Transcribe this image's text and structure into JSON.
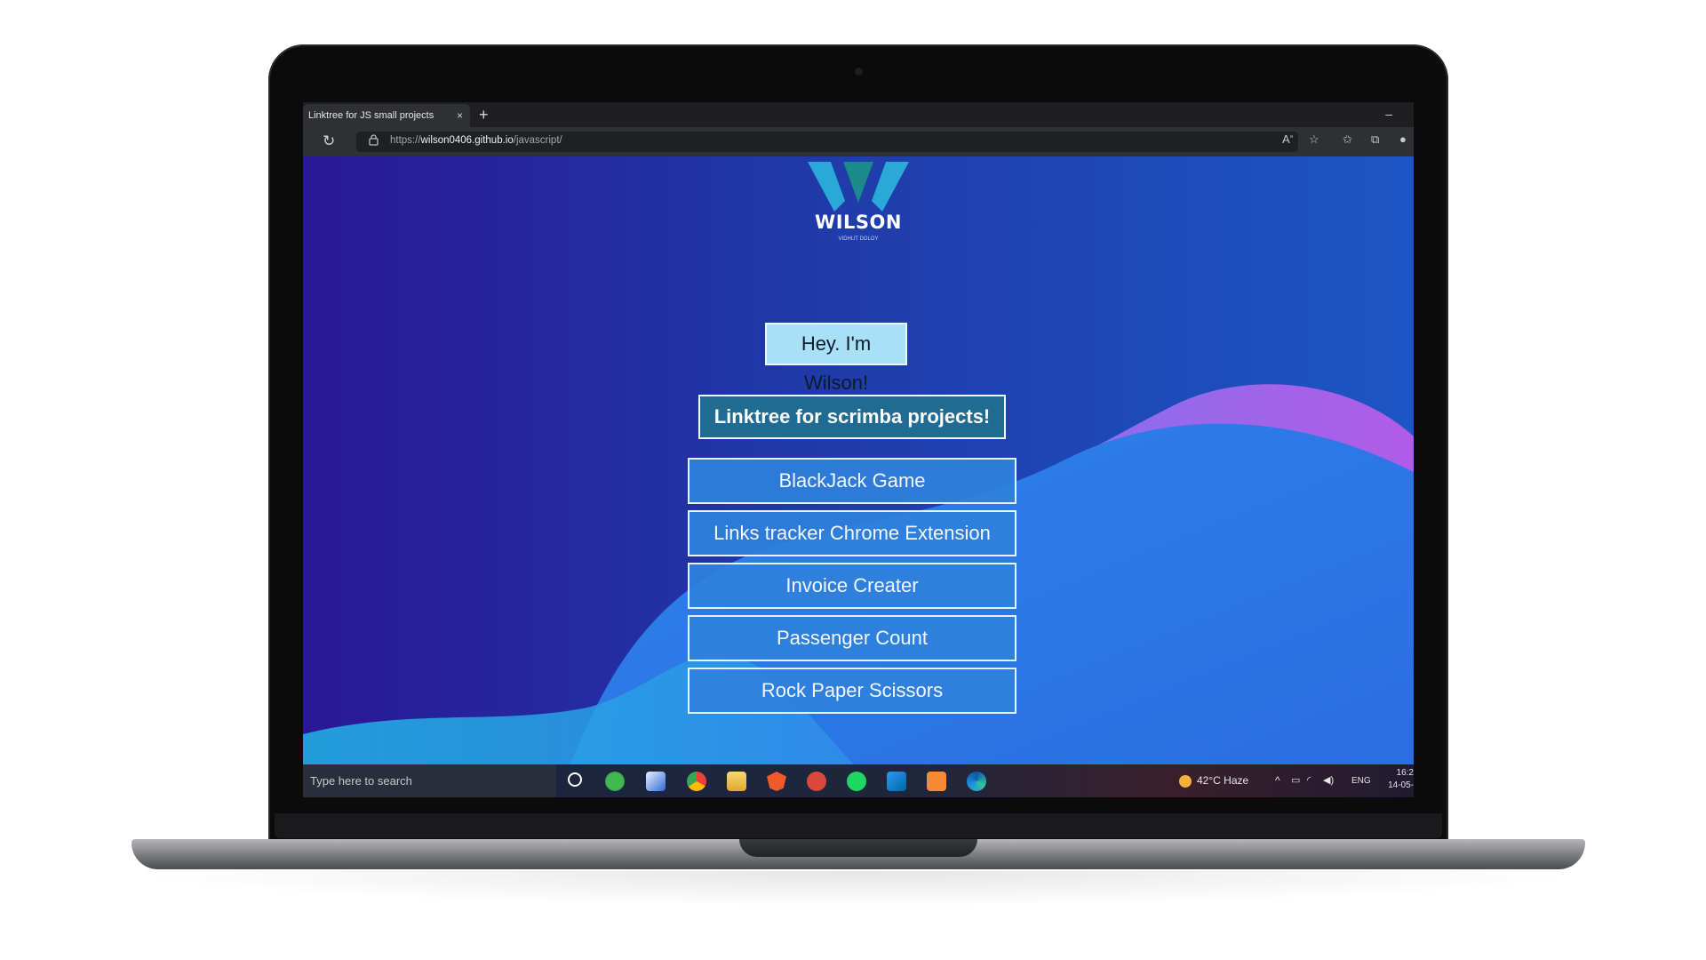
{
  "browser": {
    "tab_title": "Linktree for JS small projects",
    "tab_close": "×",
    "new_tab": "+",
    "minimize": "–",
    "reload_icon": "↻",
    "lock_icon": "🔒",
    "url_prefix": "https://",
    "url_host": "wilson0406.github.io",
    "url_path": "/javascript/"
  },
  "page": {
    "logo_text": "WILSON",
    "logo_sub": "VIDHUT DOLOY",
    "greeting": "Hey. I'm Wilson!",
    "heading": "Linktree for scrimba projects!",
    "links": [
      {
        "label": "BlackJack Game"
      },
      {
        "label": "Links tracker Chrome Extension"
      },
      {
        "label": "Invoice Creater"
      },
      {
        "label": "Passenger Count"
      },
      {
        "label": "Rock Paper Scissors"
      }
    ]
  },
  "taskbar": {
    "search_placeholder": "Type here to search",
    "weather": "42°C  Haze",
    "language": "ENG",
    "time": "16:2",
    "date": "14-05-"
  },
  "colors": {
    "bg_dark": "#2a1ea0",
    "bg_wave": "#2b73e6",
    "wave_accent": "#9b5cf0",
    "button_fill": "#3080dc",
    "heading_fill": "#1f6b92",
    "greeting_fill": "#a8e0f6"
  }
}
